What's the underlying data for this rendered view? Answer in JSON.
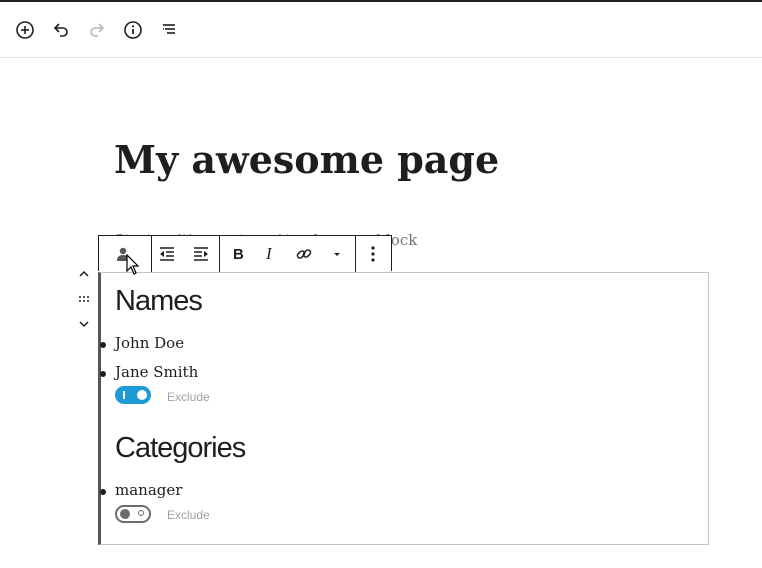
{
  "editor": {
    "page_title": "My awesome page",
    "placeholder": "Start writing or type / to choose a block"
  },
  "block": {
    "sections": [
      {
        "heading": "Names",
        "items": [
          {
            "label": "John Doe"
          },
          {
            "label": "Jane Smith"
          }
        ],
        "toggle": {
          "label": "Exclude",
          "on": true
        }
      },
      {
        "heading": "Categories",
        "items": [
          {
            "label": "manager"
          }
        ],
        "toggle": {
          "label": "Exclude",
          "on": false
        }
      }
    ]
  },
  "colors": {
    "accent": "#1e9ad6",
    "text": "#1e1e1e",
    "muted": "#a0a0a0"
  },
  "icons": {
    "top_toolbar": [
      "add-block-icon",
      "undo-icon",
      "redo-icon",
      "info-icon",
      "outline-icon"
    ],
    "block_toolbar": [
      "person-icon",
      "outdent-icon",
      "indent-icon",
      "bold-icon",
      "italic-icon",
      "link-icon",
      "dropdown-arrow-icon",
      "more-options-icon"
    ],
    "mover": [
      "move-up-icon",
      "drag-handle-icon",
      "move-down-icon"
    ]
  }
}
